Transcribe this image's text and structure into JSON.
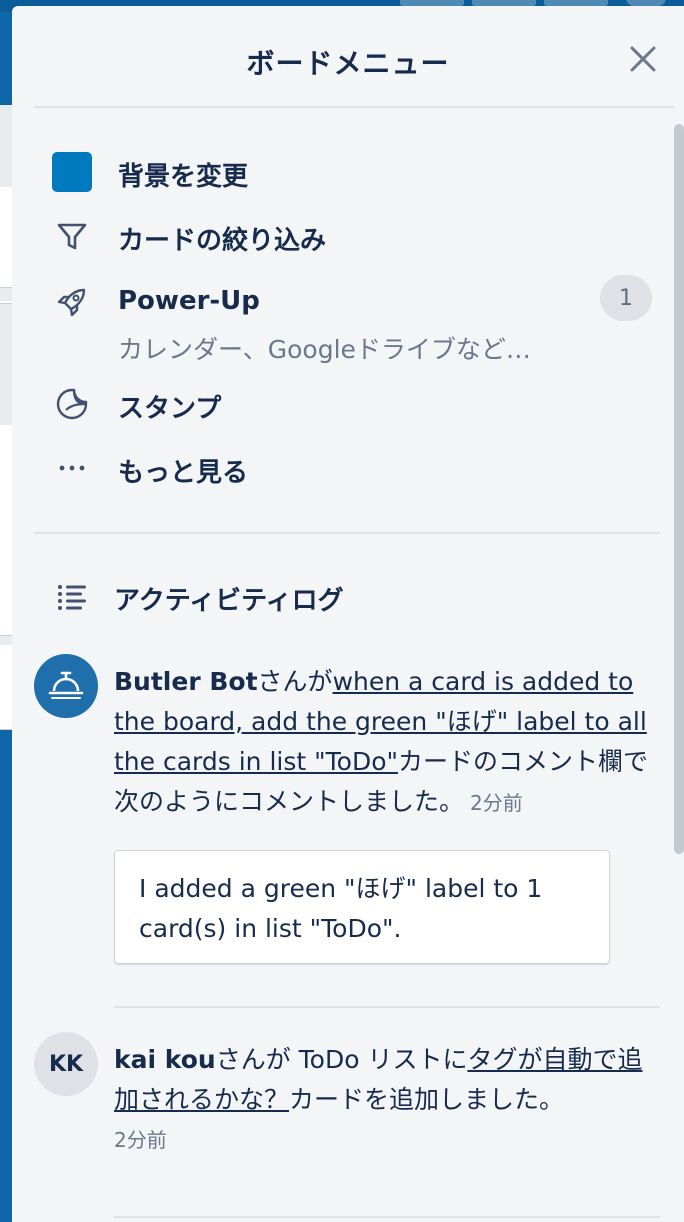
{
  "panel": {
    "title": "ボードメニュー",
    "close_icon": "close-icon"
  },
  "menu": {
    "items": [
      {
        "icon": "color-swatch-icon",
        "label": "背景を変更",
        "swatch_color": "#0079bf"
      },
      {
        "icon": "filter-icon",
        "label": "カードの絞り込み"
      },
      {
        "icon": "rocket-icon",
        "label": "Power-Up",
        "subtitle": "カレンダー、Googleドライブなど…",
        "badge": "1"
      },
      {
        "icon": "sticker-icon",
        "label": "スタンプ"
      },
      {
        "icon": "more-dots-icon",
        "label": "もっと見る"
      }
    ]
  },
  "activity": {
    "title": "アクティビティログ",
    "icon": "list-icon",
    "entries": [
      {
        "avatar_icon": "bell-icon",
        "member": "Butler Bot",
        "action_prefix": "さんが",
        "card_link": "when a card is added to the board, add the green \"ほげ\" label to all the cards in list \"ToDo\"",
        "action_suffix": "カードのコメント欄で次のようにコメントしました。",
        "time": "2分前",
        "comment": "I added a green \"ほげ\" label to 1 card(s) in list \"ToDo\"."
      },
      {
        "avatar_initials": "KK",
        "member": "kai kou",
        "action_prefix": "さんが ToDo リストに",
        "card_link": "タグが自動で追加されるかな？",
        "action_suffix": "カードを追加しました。",
        "time": "2分前"
      }
    ]
  },
  "colors": {
    "board_background": "#0f67a8",
    "panel_background": "#f4f5f7",
    "accent": "#0079bf",
    "text_primary": "#172b4d",
    "text_muted": "#6b778c"
  }
}
